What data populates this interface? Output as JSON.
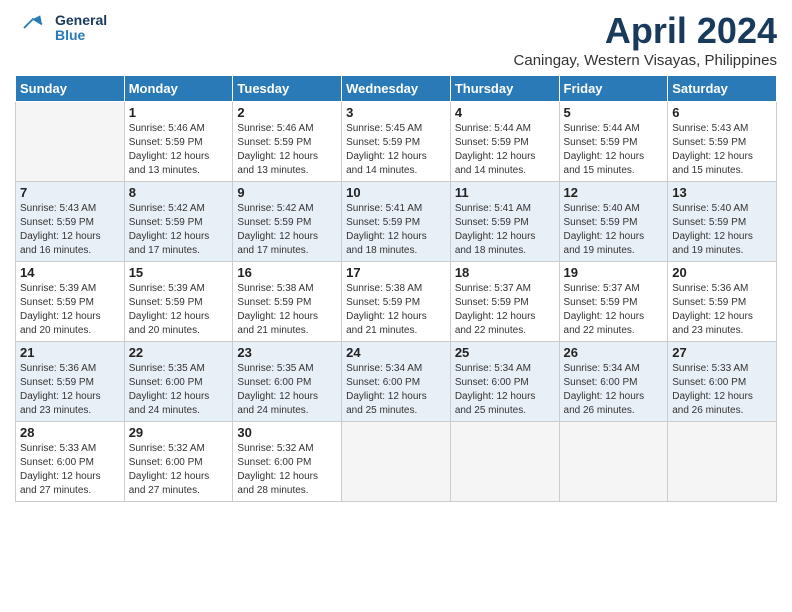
{
  "header": {
    "logo_line1": "General",
    "logo_line2": "Blue",
    "month_title": "April 2024",
    "location": "Caningay, Western Visayas, Philippines"
  },
  "days_of_week": [
    "Sunday",
    "Monday",
    "Tuesday",
    "Wednesday",
    "Thursday",
    "Friday",
    "Saturday"
  ],
  "weeks": [
    [
      {
        "day": "",
        "info": ""
      },
      {
        "day": "1",
        "info": "Sunrise: 5:46 AM\nSunset: 5:59 PM\nDaylight: 12 hours\nand 13 minutes."
      },
      {
        "day": "2",
        "info": "Sunrise: 5:46 AM\nSunset: 5:59 PM\nDaylight: 12 hours\nand 13 minutes."
      },
      {
        "day": "3",
        "info": "Sunrise: 5:45 AM\nSunset: 5:59 PM\nDaylight: 12 hours\nand 14 minutes."
      },
      {
        "day": "4",
        "info": "Sunrise: 5:44 AM\nSunset: 5:59 PM\nDaylight: 12 hours\nand 14 minutes."
      },
      {
        "day": "5",
        "info": "Sunrise: 5:44 AM\nSunset: 5:59 PM\nDaylight: 12 hours\nand 15 minutes."
      },
      {
        "day": "6",
        "info": "Sunrise: 5:43 AM\nSunset: 5:59 PM\nDaylight: 12 hours\nand 15 minutes."
      }
    ],
    [
      {
        "day": "7",
        "info": "Sunrise: 5:43 AM\nSunset: 5:59 PM\nDaylight: 12 hours\nand 16 minutes."
      },
      {
        "day": "8",
        "info": "Sunrise: 5:42 AM\nSunset: 5:59 PM\nDaylight: 12 hours\nand 17 minutes."
      },
      {
        "day": "9",
        "info": "Sunrise: 5:42 AM\nSunset: 5:59 PM\nDaylight: 12 hours\nand 17 minutes."
      },
      {
        "day": "10",
        "info": "Sunrise: 5:41 AM\nSunset: 5:59 PM\nDaylight: 12 hours\nand 18 minutes."
      },
      {
        "day": "11",
        "info": "Sunrise: 5:41 AM\nSunset: 5:59 PM\nDaylight: 12 hours\nand 18 minutes."
      },
      {
        "day": "12",
        "info": "Sunrise: 5:40 AM\nSunset: 5:59 PM\nDaylight: 12 hours\nand 19 minutes."
      },
      {
        "day": "13",
        "info": "Sunrise: 5:40 AM\nSunset: 5:59 PM\nDaylight: 12 hours\nand 19 minutes."
      }
    ],
    [
      {
        "day": "14",
        "info": "Sunrise: 5:39 AM\nSunset: 5:59 PM\nDaylight: 12 hours\nand 20 minutes."
      },
      {
        "day": "15",
        "info": "Sunrise: 5:39 AM\nSunset: 5:59 PM\nDaylight: 12 hours\nand 20 minutes."
      },
      {
        "day": "16",
        "info": "Sunrise: 5:38 AM\nSunset: 5:59 PM\nDaylight: 12 hours\nand 21 minutes."
      },
      {
        "day": "17",
        "info": "Sunrise: 5:38 AM\nSunset: 5:59 PM\nDaylight: 12 hours\nand 21 minutes."
      },
      {
        "day": "18",
        "info": "Sunrise: 5:37 AM\nSunset: 5:59 PM\nDaylight: 12 hours\nand 22 minutes."
      },
      {
        "day": "19",
        "info": "Sunrise: 5:37 AM\nSunset: 5:59 PM\nDaylight: 12 hours\nand 22 minutes."
      },
      {
        "day": "20",
        "info": "Sunrise: 5:36 AM\nSunset: 5:59 PM\nDaylight: 12 hours\nand 23 minutes."
      }
    ],
    [
      {
        "day": "21",
        "info": "Sunrise: 5:36 AM\nSunset: 5:59 PM\nDaylight: 12 hours\nand 23 minutes."
      },
      {
        "day": "22",
        "info": "Sunrise: 5:35 AM\nSunset: 6:00 PM\nDaylight: 12 hours\nand 24 minutes."
      },
      {
        "day": "23",
        "info": "Sunrise: 5:35 AM\nSunset: 6:00 PM\nDaylight: 12 hours\nand 24 minutes."
      },
      {
        "day": "24",
        "info": "Sunrise: 5:34 AM\nSunset: 6:00 PM\nDaylight: 12 hours\nand 25 minutes."
      },
      {
        "day": "25",
        "info": "Sunrise: 5:34 AM\nSunset: 6:00 PM\nDaylight: 12 hours\nand 25 minutes."
      },
      {
        "day": "26",
        "info": "Sunrise: 5:34 AM\nSunset: 6:00 PM\nDaylight: 12 hours\nand 26 minutes."
      },
      {
        "day": "27",
        "info": "Sunrise: 5:33 AM\nSunset: 6:00 PM\nDaylight: 12 hours\nand 26 minutes."
      }
    ],
    [
      {
        "day": "28",
        "info": "Sunrise: 5:33 AM\nSunset: 6:00 PM\nDaylight: 12 hours\nand 27 minutes."
      },
      {
        "day": "29",
        "info": "Sunrise: 5:32 AM\nSunset: 6:00 PM\nDaylight: 12 hours\nand 27 minutes."
      },
      {
        "day": "30",
        "info": "Sunrise: 5:32 AM\nSunset: 6:00 PM\nDaylight: 12 hours\nand 28 minutes."
      },
      {
        "day": "",
        "info": ""
      },
      {
        "day": "",
        "info": ""
      },
      {
        "day": "",
        "info": ""
      },
      {
        "day": "",
        "info": ""
      }
    ]
  ]
}
